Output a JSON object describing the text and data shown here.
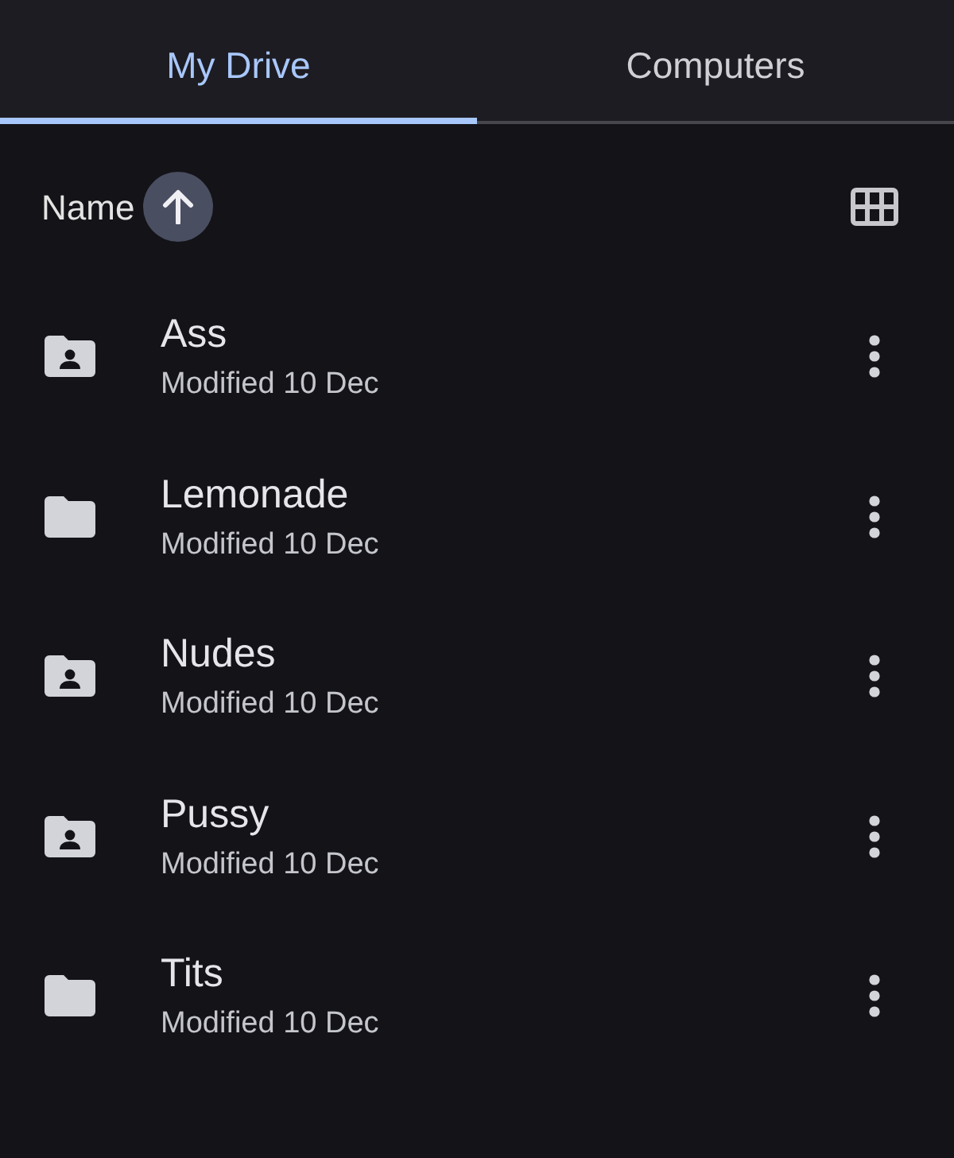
{
  "tabs": [
    {
      "label": "My Drive",
      "selected": true
    },
    {
      "label": "Computers",
      "selected": false
    }
  ],
  "sort": {
    "label": "Name",
    "ascending": true
  },
  "files": [
    {
      "kind": "shared",
      "name": "Ass",
      "modified": "Modified 10 Dec"
    },
    {
      "kind": "folder",
      "name": "Lemonade",
      "modified": "Modified 10 Dec"
    },
    {
      "kind": "shared",
      "name": "Nudes",
      "modified": "Modified 10 Dec"
    },
    {
      "kind": "shared",
      "name": "Pussy",
      "modified": "Modified 10 Dec"
    },
    {
      "kind": "folder",
      "name": "Tits",
      "modified": "Modified 10 Dec"
    }
  ]
}
